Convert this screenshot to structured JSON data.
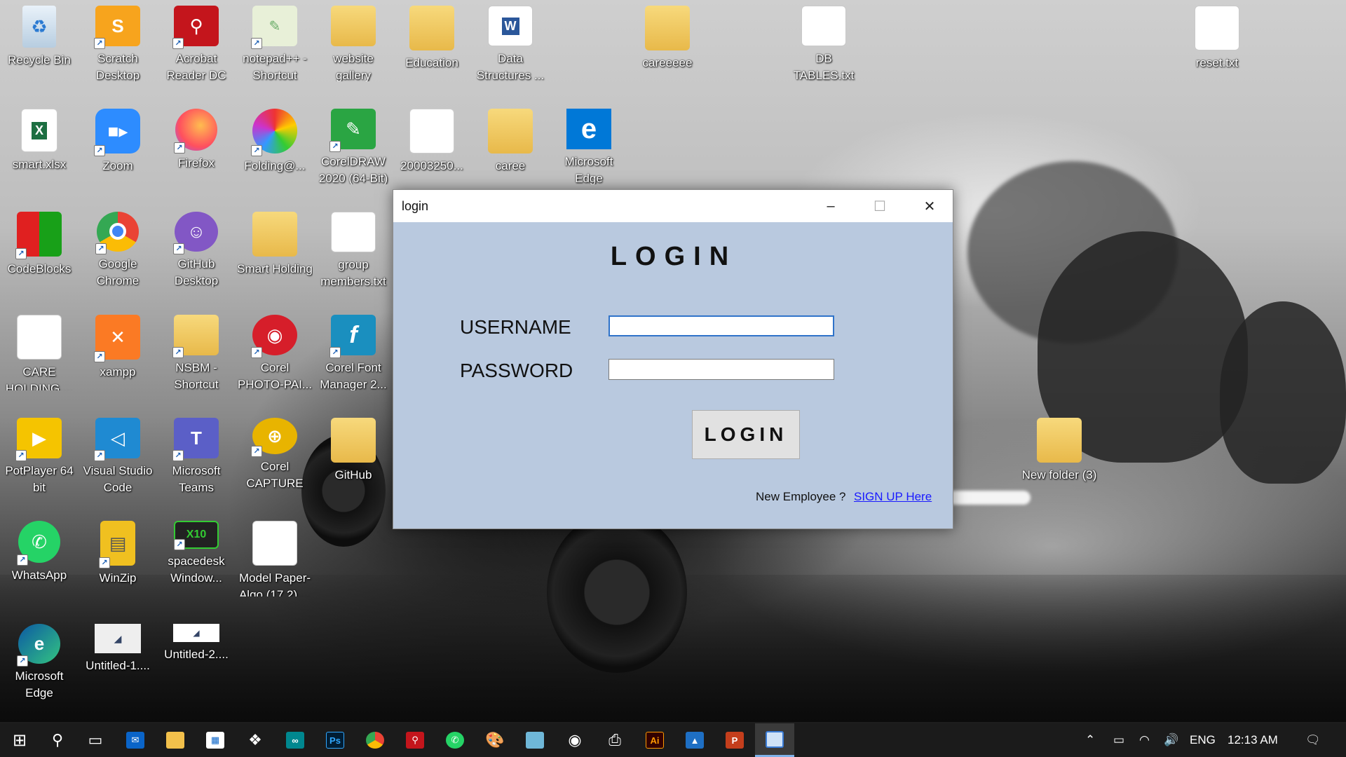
{
  "desktop": {
    "icons": [
      {
        "label": "Recycle Bin",
        "icon": "recycle-bin-icon"
      },
      {
        "label": "Scratch Desktop",
        "icon": "scratch-icon"
      },
      {
        "label": "Acrobat Reader DC",
        "icon": "acrobat-icon"
      },
      {
        "label": "notepad++ - Shortcut",
        "icon": "notepad-plus-plus-icon"
      },
      {
        "label": "website gallery",
        "icon": "folder-icon"
      },
      {
        "label": "Education",
        "icon": "folder-icon"
      },
      {
        "label": "Data Structures ...",
        "icon": "word-document-icon"
      },
      {
        "label": "careeeee",
        "icon": "folder-icon"
      },
      {
        "label": "DB TABLES.txt",
        "icon": "text-file-icon"
      },
      {
        "label": "reset.txt",
        "icon": "text-file-icon"
      },
      {
        "label": "smart.xlsx",
        "icon": "excel-icon"
      },
      {
        "label": "Zoom",
        "icon": "zoom-icon"
      },
      {
        "label": "Firefox",
        "icon": "firefox-icon"
      },
      {
        "label": "Folding@...",
        "icon": "folding-at-home-icon"
      },
      {
        "label": "CorelDRAW 2020 (64-Bit)",
        "icon": "coreldraw-icon"
      },
      {
        "label": "20003250...",
        "icon": "pdf-icon"
      },
      {
        "label": "caree",
        "icon": "folder-icon"
      },
      {
        "label": "Microsoft Edge",
        "icon": "edge-legacy-icon"
      },
      {
        "label": "CodeBlocks",
        "icon": "codeblocks-icon"
      },
      {
        "label": "Google Chrome",
        "icon": "chrome-icon"
      },
      {
        "label": "GitHub Desktop",
        "icon": "github-desktop-icon"
      },
      {
        "label": "Smart Holding",
        "icon": "folder-icon"
      },
      {
        "label": "group members.txt",
        "icon": "text-file-icon"
      },
      {
        "label": "CARE HOLDING....",
        "icon": "pdf-icon"
      },
      {
        "label": "xampp",
        "icon": "xampp-icon"
      },
      {
        "label": "NSBM - Shortcut",
        "icon": "folder-icon"
      },
      {
        "label": "Corel PHOTO-PAI...",
        "icon": "corel-photo-paint-icon"
      },
      {
        "label": "Corel Font Manager 2...",
        "icon": "corel-font-manager-icon"
      },
      {
        "label": "PotPlayer 64 bit",
        "icon": "potplayer-icon"
      },
      {
        "label": "Visual Studio Code",
        "icon": "vscode-icon"
      },
      {
        "label": "Microsoft Teams",
        "icon": "teams-icon"
      },
      {
        "label": "Corel CAPTURE 2...",
        "icon": "corel-capture-icon"
      },
      {
        "label": "GitHub",
        "icon": "folder-icon"
      },
      {
        "label": "New folder (3)",
        "icon": "folder-icon"
      },
      {
        "label": "WhatsApp",
        "icon": "whatsapp-icon"
      },
      {
        "label": "WinZip",
        "icon": "winzip-icon"
      },
      {
        "label": "spacedesk Window...",
        "icon": "spacedesk-icon"
      },
      {
        "label": "Model Paper-Algo (17.2)....",
        "icon": "pdf-icon"
      },
      {
        "label": "Microsoft Edge",
        "icon": "edge-icon"
      },
      {
        "label": "Untitled-1....",
        "icon": "image-thumbnail-icon"
      },
      {
        "label": "Untitled-2....",
        "icon": "image-thumbnail-icon"
      }
    ]
  },
  "window": {
    "title": "login",
    "heading": "LOGIN",
    "username_label": "USERNAME",
    "password_label": "PASSWORD",
    "username_value": "",
    "password_value": "",
    "login_button": "LOGIN",
    "new_employee_text": "New Employee ?",
    "signup_link": "SIGN UP Here",
    "controls": {
      "minimize": "–",
      "maximize": "☐",
      "close": "✕"
    }
  },
  "taskbar": {
    "apps": [
      "start-icon",
      "search-icon",
      "task-view-icon",
      "mail-icon",
      "file-explorer-icon",
      "microsoft-store-icon",
      "dropbox-icon",
      "arduino-icon",
      "photoshop-icon",
      "chrome-icon",
      "acrobat-icon",
      "whatsapp-icon",
      "paint-icon",
      "notes-icon",
      "media-player-icon",
      "printer-icon",
      "illustrator-icon",
      "photos-icon",
      "powerpoint-icon",
      "login-app-icon"
    ],
    "tray": {
      "language": "ENG",
      "time": "12:13 AM",
      "ps_label": "Ps",
      "ai_label": "Ai",
      "p_label": "P"
    }
  },
  "colors": {
    "window_bg": "#b9c9df",
    "link": "#1a1aff",
    "taskbar": "#1b1b1b",
    "focus_border": "#2f73c9"
  }
}
